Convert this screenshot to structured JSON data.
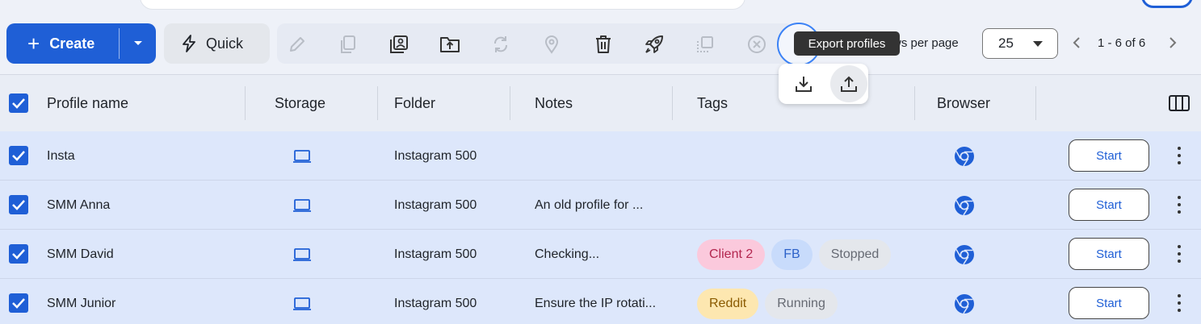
{
  "toolbar": {
    "create_label": "Create",
    "quick_label": "Quick",
    "tooltip": "Export profiles",
    "rows_per_page_label": "ws per page",
    "rows_per_page_value": "25",
    "pagination_text": "1 - 6 of 6"
  },
  "table": {
    "columns": [
      "Profile name",
      "Storage",
      "Folder",
      "Notes",
      "Tags",
      "Browser"
    ],
    "start_label": "Start",
    "rows": [
      {
        "name": "Insta",
        "folder": "Instagram 500",
        "notes": "",
        "tags": []
      },
      {
        "name": "SMM Anna",
        "folder": "Instagram 500",
        "notes": "An old profile for ...",
        "tags": []
      },
      {
        "name": "SMM David",
        "folder": "Instagram 500",
        "notes": "Checking...",
        "tags": [
          {
            "label": "Client 2",
            "bg": "#fbc9dc",
            "fg": "#b3264f"
          },
          {
            "label": "FB",
            "bg": "#c8dbfb",
            "fg": "#2d62c9"
          },
          {
            "label": "Stopped",
            "bg": "#e4e7ec",
            "fg": "#666a73"
          }
        ]
      },
      {
        "name": "SMM Junior",
        "folder": "Instagram 500",
        "notes": "Ensure the IP rotati...",
        "tags": [
          {
            "label": "Reddit",
            "bg": "#fde7b0",
            "fg": "#8a5a00"
          },
          {
            "label": "Running",
            "bg": "#e4e7ec",
            "fg": "#666a73"
          }
        ]
      }
    ]
  },
  "colors": {
    "accent": "#1f5fd6",
    "row_bg": "#dde7fb",
    "header_bg": "#e9edf5"
  }
}
